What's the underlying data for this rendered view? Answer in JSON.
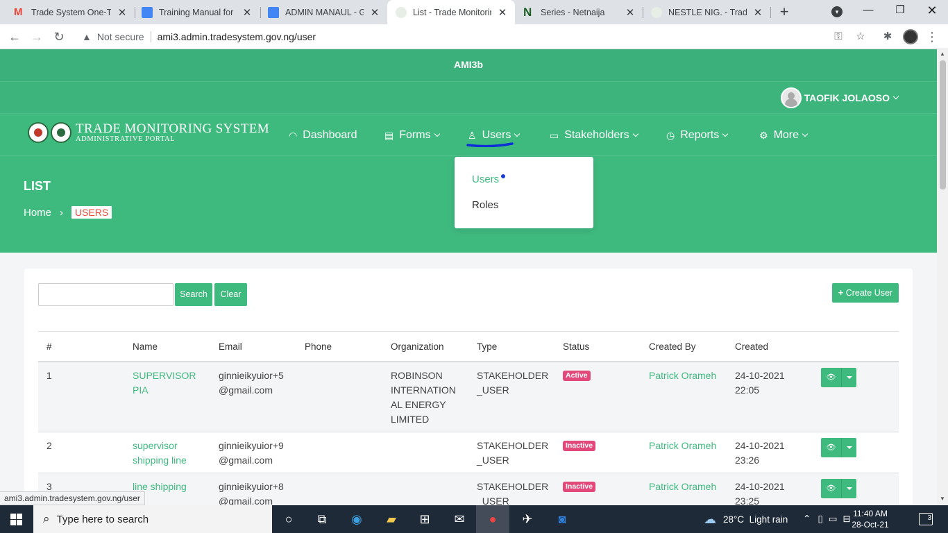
{
  "browser": {
    "tabs": [
      {
        "title": "Trade System One-Tim",
        "favicon_color": "#ea4335"
      },
      {
        "title": "Training Manual for Fo",
        "favicon_color": "#4285f4"
      },
      {
        "title": "ADMIN MANAUL - Go",
        "favicon_color": "#4285f4"
      },
      {
        "title": "List - Trade Monitoring",
        "favicon_color": "#2e7d32"
      },
      {
        "title": "Series - Netnaija",
        "favicon_color": "#1b5e20"
      },
      {
        "title": "NESTLE NIG. - Trade M",
        "favicon_color": "#2e7d32"
      }
    ],
    "address": {
      "security": "Not secure",
      "url": "ami3.admin.tradesystem.gov.ng/user"
    },
    "status_url": "ami3.admin.tradesystem.gov.ng/user"
  },
  "header": {
    "app_name": "AMI3b",
    "user_name": "TAOFIK JOLAOSO",
    "logo_title": "TRADE MONITORING SYSTEM",
    "logo_subtitle": "ADMINISTRATIVE PORTAL",
    "nav": [
      {
        "label": "Dashboard",
        "icon": "gauge-icon"
      },
      {
        "label": "Forms",
        "icon": "document-icon"
      },
      {
        "label": "Users",
        "icon": "user-icon"
      },
      {
        "label": "Stakeholders",
        "icon": "briefcase-icon"
      },
      {
        "label": "Reports",
        "icon": "clock-icon"
      },
      {
        "label": "More",
        "icon": "gear-icon"
      }
    ],
    "users_dropdown": [
      "Users",
      "Roles"
    ]
  },
  "page": {
    "title": "LIST",
    "breadcrumb": {
      "home": "Home",
      "current": "USERS"
    }
  },
  "toolbar": {
    "search_value": "",
    "search_label": "Search",
    "clear_label": "Clear",
    "create_label": "Create User"
  },
  "table": {
    "columns": [
      "#",
      "Name",
      "Email",
      "Phone",
      "Organization",
      "Type",
      "Status",
      "Created By",
      "Created"
    ],
    "rows": [
      {
        "num": "1",
        "name": "SUPERVISOR PIA",
        "email": "ginnieikyuior+5 @gmail.com",
        "phone": "",
        "org": "ROBINSON INTERNATION AL ENERGY LIMITED",
        "type": "STAKEHOLDER _USER",
        "status": "Active",
        "created_by": "Patrick Orameh",
        "created": "24-10-2021 22:05"
      },
      {
        "num": "2",
        "name": "supervisor shipping line",
        "email": "ginnieikyuior+9 @gmail.com",
        "phone": "",
        "org": "",
        "type": "STAKEHOLDER _USER",
        "status": "Inactive",
        "created_by": "Patrick Orameh",
        "created": "24-10-2021 23:26"
      },
      {
        "num": "3",
        "name": "line shipping",
        "email": "ginnieikyuior+8 @gmail.com",
        "phone": "",
        "org": "",
        "type": "STAKEHOLDER _USER",
        "status": "Inactive",
        "created_by": "Patrick Orameh",
        "created": "24-10-2021 23:25"
      }
    ]
  },
  "taskbar": {
    "search_placeholder": "Type here to search",
    "weather": "28°C  Light rain",
    "time": "11:40 AM",
    "date": "28-Oct-21",
    "notifications": "3"
  },
  "colors": {
    "primary": "#3fba7f",
    "badge_status": "#e2487a",
    "breadcrumb_current": "#e74c3c"
  }
}
